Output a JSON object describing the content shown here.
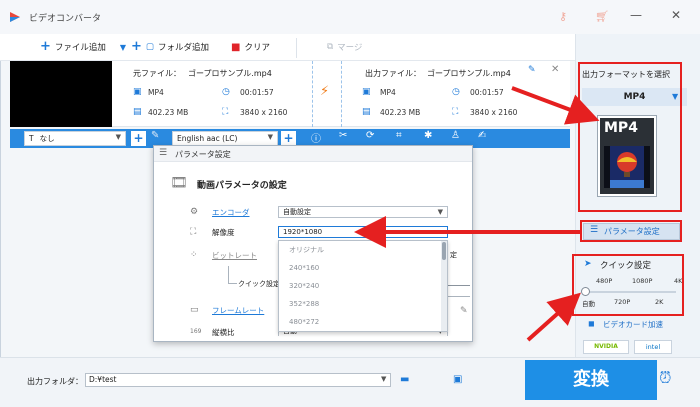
{
  "window": {
    "title": "ビデオコンバータ"
  },
  "toolbar": {
    "add_file": "ファイル追加",
    "add_folder": "フォルダ追加",
    "clear": "クリア",
    "merge": "マージ"
  },
  "file": {
    "source_label": "元ファイル：",
    "source_name": "ゴープロサンプル.mp4",
    "output_label": "出力ファイル：",
    "output_name": "ゴープロサンプル.mp4",
    "src_format": "MP4",
    "src_duration": "00:01:57",
    "src_size": "402.23 MB",
    "src_resolution": "3840 x 2160",
    "out_format": "MP4",
    "out_duration": "00:01:57",
    "out_size": "402.23 MB",
    "out_resolution": "3840 x 2160"
  },
  "bluebar": {
    "subtitle": "なし",
    "audio": "English aac (LC)"
  },
  "dialog": {
    "title": "パラメータ設定",
    "section": "動画パラメータの設定",
    "encoder_label": "エンコーダ",
    "encoder_value": "自動設定",
    "resolution_label": "解像度",
    "resolution_value": "1920*1080",
    "bitrate_label": "ビットレート",
    "quick_label": "クイック設定",
    "framerate_label": "フレームレート",
    "aspect_label": "縦横比",
    "aspect_value": "自動",
    "partial_label": "定",
    "options": [
      "オリジナル",
      "240*160",
      "320*240",
      "352*288",
      "480*272"
    ]
  },
  "right_panel": {
    "format_heading": "出力フォーマットを選択",
    "format_selected": "MP4",
    "format_card": "MP4",
    "param_button": "パラメータ設定",
    "quick_title": "クイック設定",
    "quick_top": [
      "480P",
      "1080P",
      "4K"
    ],
    "quick_bottom": [
      "自動",
      "720P",
      "2K"
    ],
    "hw_accel": "ビデオカード加速",
    "nvidia": "NVIDIA",
    "intel": "intel"
  },
  "bottom": {
    "output_folder_label": "出力フォルダ：",
    "output_folder_value": "D:¥test",
    "convert_button": "変換"
  },
  "colors": {
    "accent": "#1e7ad8",
    "convert": "#1e8fe6",
    "highlight": "#e52020"
  }
}
